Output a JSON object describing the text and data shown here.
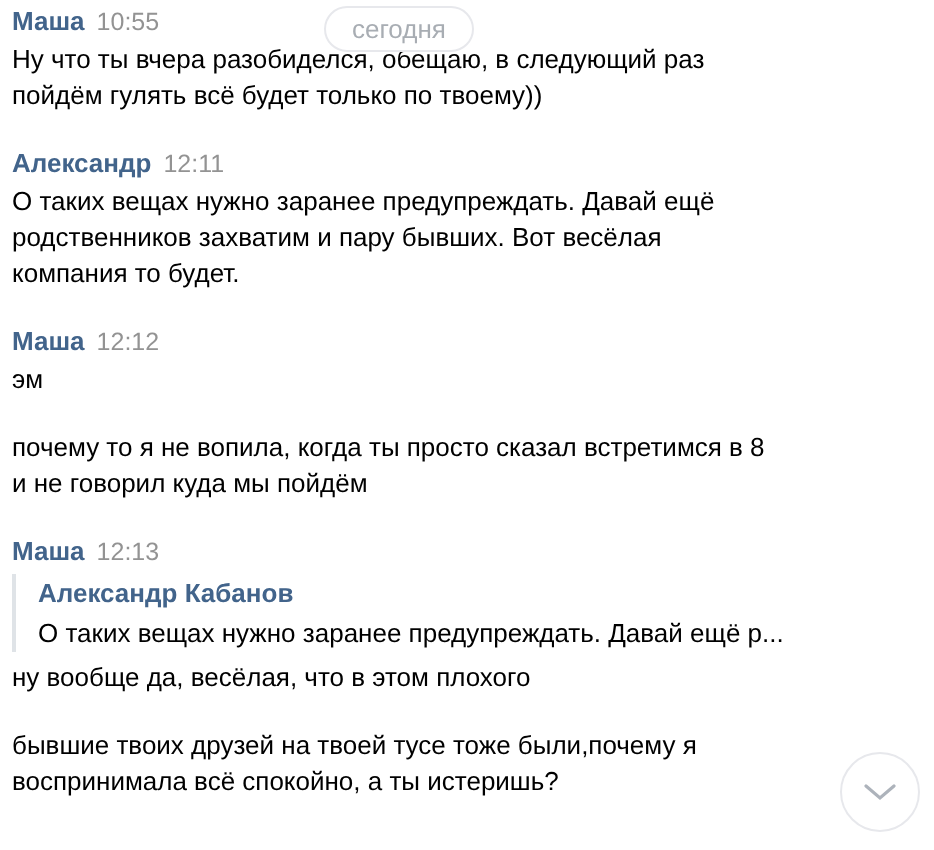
{
  "date_pill": "сегодня",
  "groups": [
    {
      "author": "Маша",
      "time": "10:55",
      "messages": [
        {
          "text": "Ну что ты вчера разобиделся, обещаю, в следующий раз\nпойдём гулять всё будет только по твоему))"
        }
      ]
    },
    {
      "author": "Александр",
      "time": "12:11",
      "messages": [
        {
          "text": "О таких вещах нужно заранее предупреждать. Давай ещё\nродственников захватим и пару бывших. Вот весёлая\nкомпания то будет."
        }
      ]
    },
    {
      "author": "Маша",
      "time": "12:12",
      "messages": [
        {
          "text": "эм"
        },
        {
          "text": "почему то я не вопила, когда ты просто сказал встретимся в 8\nи не говорил куда мы пойдём"
        }
      ]
    },
    {
      "author": "Маша",
      "time": "12:13",
      "quote": {
        "author": "Александр Кабанов",
        "text": "О таких вещах нужно заранее предупреждать. Давай ещё р..."
      },
      "messages": [
        {
          "text": "ну вообще да, весёлая, что в этом плохого"
        },
        {
          "text": "бывшие твоих друзей на твоей тусе тоже были,почему я\nвоспринимала всё спокойно, а ты истеришь?"
        }
      ]
    }
  ]
}
